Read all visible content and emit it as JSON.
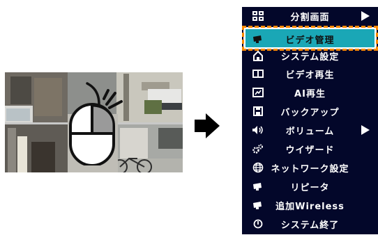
{
  "menu": {
    "items": [
      {
        "label": "分割画面",
        "icon": "grid-icon",
        "has_submenu": true,
        "selected": false
      },
      {
        "label": "ビデオ管理",
        "icon": "camera-icon",
        "has_submenu": false,
        "selected": true
      },
      {
        "label": "システム設定",
        "icon": "home-icon",
        "has_submenu": false,
        "selected": false
      },
      {
        "label": "ビデオ再生",
        "icon": "playback-icon",
        "has_submenu": false,
        "selected": false
      },
      {
        "label": "AI再生",
        "icon": "ai-chart-icon",
        "has_submenu": false,
        "selected": false
      },
      {
        "label": "バックアップ",
        "icon": "save-icon",
        "has_submenu": false,
        "selected": false
      },
      {
        "label": "ボリューム",
        "icon": "speaker-icon",
        "has_submenu": true,
        "selected": false
      },
      {
        "label": "ウイザード",
        "icon": "wizard-gears-icon",
        "has_submenu": false,
        "selected": false
      },
      {
        "label": "ネットワーク設定",
        "icon": "globe-icon",
        "has_submenu": false,
        "selected": false
      },
      {
        "label": "リピータ",
        "icon": "repeater-camera-icon",
        "has_submenu": false,
        "selected": false
      },
      {
        "label": "追加Wireless",
        "icon": "wireless-camera-icon",
        "has_submenu": false,
        "selected": false
      },
      {
        "label": "システム終了",
        "icon": "power-icon",
        "has_submenu": false,
        "selected": false
      }
    ],
    "colors": {
      "background": "#03072a",
      "highlight": "#1aa7b6",
      "highlight_border": "#ff8a00",
      "text": "#ffffff"
    }
  },
  "preview": {
    "icon": "mouse-right-click-icon"
  },
  "transition": {
    "icon": "right-arrow-icon"
  }
}
